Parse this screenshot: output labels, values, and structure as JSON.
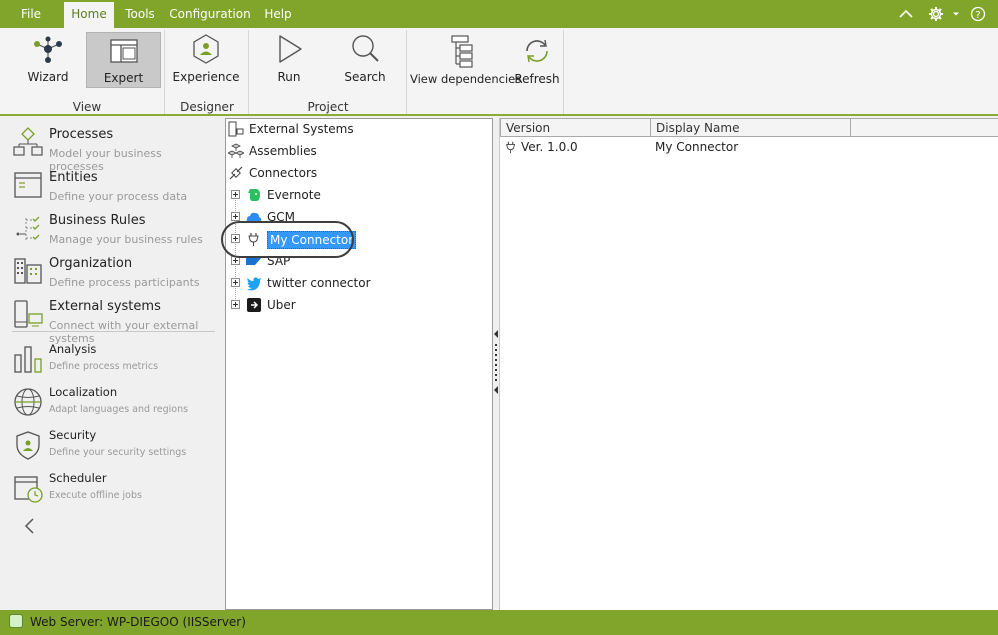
{
  "menubar": {
    "items": [
      "File",
      "Home",
      "Tools",
      "Configuration",
      "Help"
    ],
    "active": "Home"
  },
  "ribbon": {
    "buttons": {
      "wizard": "Wizard",
      "expert": "Expert",
      "experience": "Experience",
      "run": "Run",
      "search": "Search",
      "view_dependencies": "View dependencies",
      "refresh": "Refresh"
    },
    "groups": {
      "view": "View",
      "designer": "Designer",
      "project": "Project"
    }
  },
  "sidebar": {
    "items": [
      {
        "title": "Processes",
        "subtitle": "Model your business processes",
        "icon": "processes-icon"
      },
      {
        "title": "Entities",
        "subtitle": "Define your process data",
        "icon": "entities-icon"
      },
      {
        "title": "Business Rules",
        "subtitle": "Manage your business rules",
        "icon": "business-rules-icon"
      },
      {
        "title": "Organization",
        "subtitle": "Define process participants",
        "icon": "organization-icon"
      },
      {
        "title": "External systems",
        "subtitle": "Connect with your external systems",
        "icon": "external-systems-icon"
      },
      {
        "title": "Analysis",
        "subtitle": "Define process metrics",
        "icon": "analysis-icon"
      },
      {
        "title": "Localization",
        "subtitle": "Adapt languages and regions",
        "icon": "localization-icon"
      },
      {
        "title": "Security",
        "subtitle": "Define your security settings",
        "icon": "security-icon"
      },
      {
        "title": "Scheduler",
        "subtitle": "Execute offline jobs",
        "icon": "scheduler-icon"
      }
    ]
  },
  "tree": {
    "roots": {
      "external_systems": "External Systems",
      "assemblies": "Assemblies",
      "connectors": "Connectors"
    },
    "connectors": [
      "Evernote",
      "GCM",
      "My Connector",
      "SAP",
      "twitter connector",
      "Uber"
    ],
    "selected": "My Connector"
  },
  "grid": {
    "columns": [
      "Version",
      "Display Name",
      ""
    ],
    "rows": [
      {
        "version": "Ver. 1.0.0",
        "display_name": "My Connector"
      }
    ]
  },
  "status": {
    "text": "Web Server: WP-DIEGOO (IISServer)"
  },
  "colors": {
    "accent": "#80a52a",
    "selection": "#3399ff"
  }
}
